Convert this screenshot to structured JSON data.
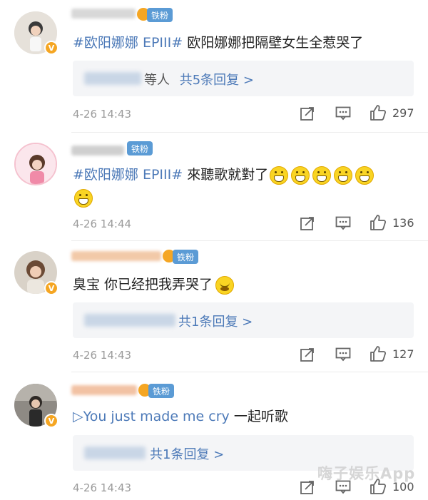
{
  "comments": [
    {
      "text_topic": "#欧阳娜娜 EPIII#",
      "text_body": " 欧阳娜娜把隔壁女生全惹哭了",
      "reply_prefix": "等人",
      "reply_link": "共5条回复 >",
      "timestamp": "4-26 14:43",
      "likes": "297"
    },
    {
      "text_topic": "#欧阳娜娜 EPIII#",
      "text_body": " 來聽歌就對了",
      "emoji_count": "5 grin emojis + 1",
      "timestamp": "4-26 14:44",
      "likes": "136",
      "badge": "铁粉"
    },
    {
      "text_body": "臭宝 你已经把我弄哭了",
      "reply_link": "共1条回复 >",
      "timestamp": "4-26 14:43",
      "likes": "127",
      "badge": "铁粉"
    },
    {
      "text_link": "▷You just made me cry",
      "text_body": " 一起听歌",
      "reply_link": "共1条回复 >",
      "timestamp": "4-26 14:43",
      "likes": "100",
      "badge": "铁粉"
    }
  ],
  "badges": {
    "first": "铁粉"
  },
  "watermark": "嗨子娱乐App",
  "colors": {
    "link": "#4d7ab8",
    "fan_badge": "#5b9bd5",
    "verified": "#f5a623"
  },
  "icons": [
    "share-icon",
    "comment-icon",
    "like-icon",
    "verified-badge-icon"
  ]
}
